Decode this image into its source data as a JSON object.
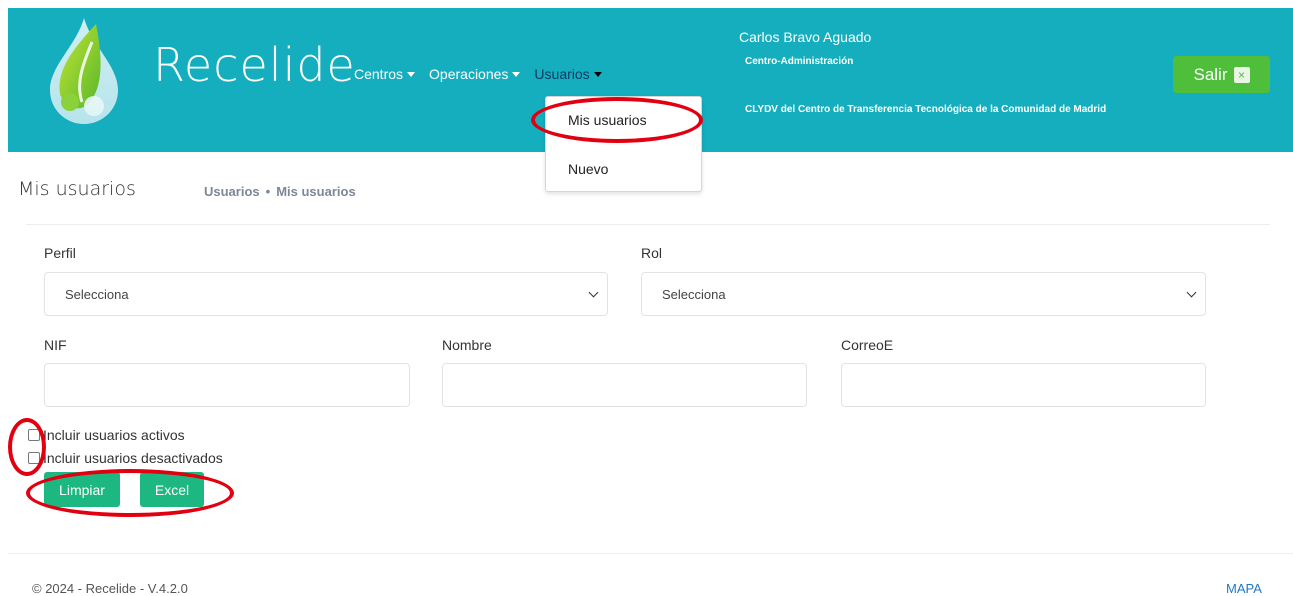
{
  "header": {
    "brand": "Recelide",
    "nav": [
      {
        "label": "Centros"
      },
      {
        "label": "Operaciones"
      },
      {
        "label": "Usuarios"
      }
    ],
    "user_name": "Carlos Bravo Aguado",
    "user_center": "Centro-Administración",
    "user_org": "CLYDV del Centro de Transferencia Tecnológica de la Comunidad de Madrid",
    "logout_label": "Salir",
    "logout_icon": "×"
  },
  "dropdown": {
    "items": [
      {
        "label": "Mis usuarios"
      },
      {
        "label": "Nuevo"
      }
    ]
  },
  "page": {
    "title": "Mis usuarios",
    "breadcrumb": [
      "Usuarios",
      "Mis usuarios"
    ],
    "breadcrumb_sep": "•"
  },
  "form": {
    "perfil_label": "Perfil",
    "perfil_value": "Selecciona",
    "rol_label": "Rol",
    "rol_value": "Selecciona",
    "nif_label": "NIF",
    "nombre_label": "Nombre",
    "correo_label": "CorreoE",
    "check_activos": "Incluir usuarios activos",
    "check_desactivados": "Incluir usuarios desactivados",
    "btn_limpiar": "Limpiar",
    "btn_excel": "Excel"
  },
  "footer": {
    "copyright": "© 2024 - Recelide - V.4.2.0",
    "mapa": "MAPA"
  },
  "colors": {
    "header_bg": "#15aebf",
    "logout_bg": "#4fbe3a",
    "button_bg": "#1db782",
    "annotation": "#e20010"
  }
}
